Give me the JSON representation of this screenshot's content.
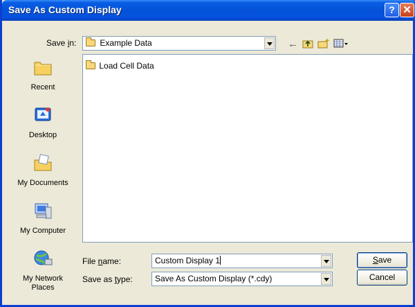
{
  "window": {
    "title": "Save As Custom Display",
    "help_label": "?",
    "close_label": "✕",
    "title_gradient": [
      "#3a8cf7",
      "#0453d8"
    ]
  },
  "save_in": {
    "label_prefix": "Save ",
    "label_mnemonic": "i",
    "label_suffix": "n:",
    "value": "Example Data"
  },
  "toolbar": {
    "back_icon": "back-arrow-icon",
    "up_icon": "up-folder-icon",
    "new_folder_icon": "new-folder-icon",
    "views_icon": "views-menu-icon"
  },
  "places": [
    {
      "label": "Recent",
      "icon": "recent-icon"
    },
    {
      "label": "Desktop",
      "icon": "desktop-icon"
    },
    {
      "label": "My Documents",
      "icon": "my-documents-icon"
    },
    {
      "label": "My Computer",
      "icon": "my-computer-icon"
    },
    {
      "label": "My Network Places",
      "icon": "network-places-icon"
    }
  ],
  "files": [
    {
      "name": "Load Cell Data",
      "icon": "folder-icon"
    }
  ],
  "file_name": {
    "label_prefix": "File ",
    "label_mnemonic": "n",
    "label_suffix": "ame:",
    "value": "Custom Display 1"
  },
  "save_as_type": {
    "label_prefix": "Save as ",
    "label_mnemonic": "t",
    "label_suffix": "ype:",
    "value": "Save As Custom Display (*.cdy)"
  },
  "buttons": {
    "save_mnemonic": "S",
    "save_rest": "ave",
    "cancel": "Cancel"
  }
}
